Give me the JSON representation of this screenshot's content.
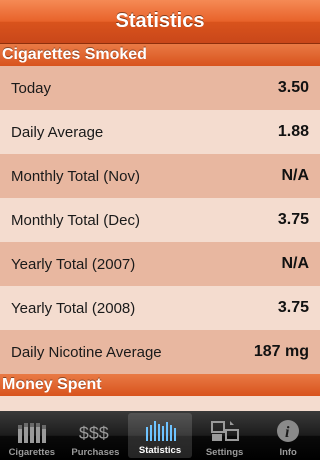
{
  "navbar": {
    "title": "Statistics"
  },
  "sections": {
    "cigarettes": {
      "header": "Cigarettes Smoked",
      "rows": [
        {
          "label": "Today",
          "value": "3.50"
        },
        {
          "label": "Daily Average",
          "value": "1.88"
        },
        {
          "label": "Monthly Total (Nov)",
          "value": "N/A"
        },
        {
          "label": "Monthly Total (Dec)",
          "value": "3.75"
        },
        {
          "label": "Yearly Total (2007)",
          "value": "N/A"
        },
        {
          "label": "Yearly Total (2008)",
          "value": "3.75"
        },
        {
          "label": "Daily Nicotine Average",
          "value": "187 mg"
        }
      ]
    },
    "money": {
      "header": "Money Spent"
    }
  },
  "tabbar": {
    "tabs": [
      {
        "label": "Cigarettes",
        "icon": "cigarettes-icon"
      },
      {
        "label": "Purchases",
        "icon": "dollar-signs-icon"
      },
      {
        "label": "Statistics",
        "icon": "bar-chart-icon",
        "selected": true
      },
      {
        "label": "Settings",
        "icon": "settings-icon"
      },
      {
        "label": "Info",
        "icon": "info-icon"
      }
    ]
  },
  "colors": {
    "navbar": "#e8622a",
    "row_odd": "#e8b7a0",
    "row_even": "#f4dccf",
    "tabbar": "#1c1c1c"
  }
}
